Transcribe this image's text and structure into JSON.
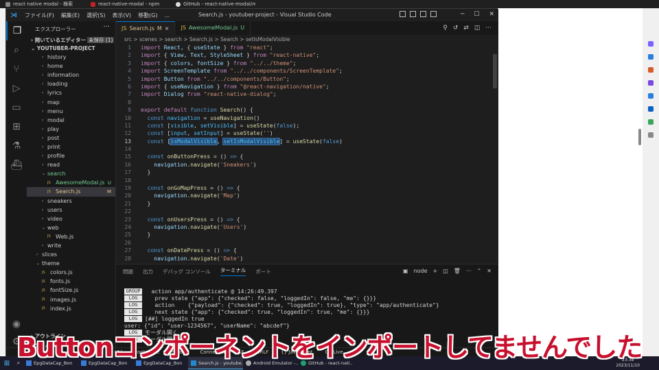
{
  "browser": {
    "tabs": [
      "react native modal - 検索",
      "react-native-modal - npm",
      "GitHub - react-native-modal/rea..."
    ]
  },
  "vscode": {
    "title": "Search.js - youtuber-project - Visual Studio Code",
    "menu": [
      "ファイル(F)",
      "編集(E)",
      "選択(S)",
      "表示(V)",
      "移動(G)",
      "..."
    ],
    "sidebar": {
      "header": "エクスプローラー",
      "open_editors": "開いているエディター",
      "unsaved": "未保存 (1)",
      "project": "YOUTUBER-PROJECT",
      "outline": "アウトライン",
      "timeline": "タイムライン",
      "tree": [
        {
          "label": "history",
          "kind": "folder",
          "indent": 2
        },
        {
          "label": "home",
          "kind": "folder",
          "indent": 2
        },
        {
          "label": "information",
          "kind": "folder",
          "indent": 2
        },
        {
          "label": "loading",
          "kind": "folder",
          "indent": 2
        },
        {
          "label": "lyrics",
          "kind": "folder",
          "indent": 2
        },
        {
          "label": "map",
          "kind": "folder",
          "indent": 2
        },
        {
          "label": "menu",
          "kind": "folder",
          "indent": 2
        },
        {
          "label": "modal",
          "kind": "folder",
          "indent": 2
        },
        {
          "label": "play",
          "kind": "folder",
          "indent": 2
        },
        {
          "label": "post",
          "kind": "folder",
          "indent": 2
        },
        {
          "label": "print",
          "kind": "folder",
          "indent": 2
        },
        {
          "label": "profile",
          "kind": "folder",
          "indent": 2
        },
        {
          "label": "read",
          "kind": "folder",
          "indent": 2
        },
        {
          "label": "search",
          "kind": "folder-open",
          "indent": 2,
          "status": "new"
        },
        {
          "label": "AwesomeModal.js",
          "kind": "file",
          "indent": 3,
          "status": "new",
          "badge": "U"
        },
        {
          "label": "Search.js",
          "kind": "file",
          "indent": 3,
          "status": "mod",
          "badge": "M",
          "selected": true
        },
        {
          "label": "sneakers",
          "kind": "folder",
          "indent": 2
        },
        {
          "label": "users",
          "kind": "folder",
          "indent": 2
        },
        {
          "label": "video",
          "kind": "folder",
          "indent": 2
        },
        {
          "label": "web",
          "kind": "folder-open",
          "indent": 2
        },
        {
          "label": "Web.js",
          "kind": "file",
          "indent": 3
        },
        {
          "label": "write",
          "kind": "folder",
          "indent": 2
        },
        {
          "label": "slices",
          "kind": "folder",
          "indent": 1
        },
        {
          "label": "theme",
          "kind": "folder-open",
          "indent": 1
        },
        {
          "label": "colors.js",
          "kind": "file",
          "indent": 2
        },
        {
          "label": "fonts.js",
          "kind": "file",
          "indent": 2
        },
        {
          "label": "fontSize.js",
          "kind": "file",
          "indent": 2
        },
        {
          "label": "images.js",
          "kind": "file",
          "indent": 2
        },
        {
          "label": "index.js",
          "kind": "file",
          "indent": 2
        }
      ]
    },
    "tabs": [
      {
        "name": "Search.js",
        "badge": "M",
        "active": true
      },
      {
        "name": "AwesomeModal.js",
        "badge": "U",
        "active": false
      }
    ],
    "breadcrumb": "src > scenes > search > Search.js > Search > setIsModalVisible",
    "current_line": 13,
    "code_lines": [
      {
        "n": 1,
        "html": "<span class='kw'>import</span> <span class='vr'>React</span>, { <span class='vr'>useState</span> } <span class='kw'>from</span> <span class='str'>\"react\"</span>;"
      },
      {
        "n": 2,
        "html": "<span class='kw'>import</span> { <span class='vr'>View</span>, <span class='vr'>Text</span>, <span class='vr'>StyleSheet</span> } <span class='kw'>from</span> <span class='str'>\"react-native\"</span>;"
      },
      {
        "n": 3,
        "html": "<span class='kw'>import</span> { <span class='vr'>colors</span>, <span class='vr'>fontSize</span> } <span class='kw'>from</span> <span class='str'>\"../../theme\"</span>;"
      },
      {
        "n": 4,
        "html": "<span class='kw'>import</span> <span class='vr'>ScreenTemplate</span> <span class='kw'>from</span> <span class='str'>\"../../components/ScreenTemplate\"</span>;"
      },
      {
        "n": 5,
        "html": "<span class='kw'>import</span> <span class='vr'>Button</span> <span class='kw'>from</span> <span class='str'>\"../../components/Button\"</span>;"
      },
      {
        "n": 6,
        "html": "<span class='kw'>import</span> { <span class='vr'>useNavigation</span> } <span class='kw'>from</span> <span class='str'>\"@react-navigation/native\"</span>;"
      },
      {
        "n": 7,
        "html": "<span class='kw'>import</span> <span class='vr'>Dialog</span> <span class='kw'>from</span> <span class='str'>\"react-native-dialog\"</span>;"
      },
      {
        "n": 8,
        "html": ""
      },
      {
        "n": 9,
        "html": "<span class='kw'>export</span> <span class='kw'>default</span> <span class='kb'>function</span> <span class='fn'>Search</span>() {"
      },
      {
        "n": 10,
        "html": "  <span class='kb'>const</span> <span class='cn'>navigation</span> = <span class='fn'>useNavigation</span>()"
      },
      {
        "n": 11,
        "html": "  <span class='kb'>const</span> [<span class='cn'>visible</span>, <span class='cn'>setVisible</span>] = <span class='fn'>useState</span>(<span class='kb'>false</span>);"
      },
      {
        "n": 12,
        "html": "  <span class='kb'>const</span> [<span class='cn'>input</span>, <span class='cn'>setInput</span>] = <span class='fn'>useState</span>(<span class='str'>''</span>)"
      },
      {
        "n": 13,
        "html": "  <span class='kb'>const</span> [<span class='cn hl'>isModalVisible</span>, <span class='cn hl'>setIsModalVisible</span>] = <span class='fn'>useState</span>(<span class='kb'>false</span>)"
      },
      {
        "n": 14,
        "html": ""
      },
      {
        "n": 15,
        "html": "  <span class='kb'>const</span> <span class='fn'>onButtonPress</span> = () <span class='kb'>=&gt;</span> {"
      },
      {
        "n": 16,
        "html": "    <span class='vr'>navigation</span>.<span class='fn'>navigate</span>(<span class='str'>'Sneakers'</span>)"
      },
      {
        "n": 17,
        "html": "  }"
      },
      {
        "n": 18,
        "html": ""
      },
      {
        "n": 19,
        "html": "  <span class='kb'>const</span> <span class='fn'>onGoMapPress</span> = () <span class='kb'>=&gt;</span> {"
      },
      {
        "n": 20,
        "html": "    <span class='vr'>navigation</span>.<span class='fn'>navigate</span>(<span class='str'>'Map'</span>)"
      },
      {
        "n": 21,
        "html": "  }"
      },
      {
        "n": 22,
        "html": ""
      },
      {
        "n": 23,
        "html": "  <span class='kb'>const</span> <span class='fn'>onUsersPress</span> = () <span class='kb'>=&gt;</span> {"
      },
      {
        "n": 24,
        "html": "    <span class='vr'>navigation</span>.<span class='fn'>navigate</span>(<span class='str'>'Users'</span>)"
      },
      {
        "n": 25,
        "html": "  }"
      },
      {
        "n": 26,
        "html": ""
      },
      {
        "n": 27,
        "html": "  <span class='kb'>const</span> <span class='fn'>onDatePress</span> = () <span class='kb'>=&gt;</span> {"
      },
      {
        "n": 28,
        "html": "    <span class='vr'>navigation</span>.<span class='fn'>navigate</span>(<span class='str'>'Date'</span>)"
      }
    ],
    "panel": {
      "tabs": [
        "問題",
        "出力",
        "デバッグ コンソール",
        "ターミナル",
        "ポート"
      ],
      "active_tab": "ターミナル",
      "terminal_name": "node",
      "lines": [
        {
          "label": "GROUP",
          "text": "  action app/authenticate @ 14:26:49.397"
        },
        {
          "label": "LOG",
          "text": "   prev state {\"app\": {\"checked\": false, \"loggedIn\": false, \"me\": {}}}"
        },
        {
          "label": "LOG",
          "text": "   action    {\"payload\": {\"checked\": true, \"loggedIn\": true}, \"type\": \"app/authenticate\"}"
        },
        {
          "label": "LOG",
          "text": "   next state {\"app\": {\"checked\": true, \"loggedIn\": true, \"me\": {}}}"
        },
        {
          "label": "LOG",
          "text": "[##] loggedIn true"
        },
        {
          "label": "",
          "text": "user: {\"id\": \"user-1234567\", \"userName\": \"abcdef\"}"
        },
        {
          "label": "LOG",
          "text": "モーダル開く"
        },
        {
          "label": "LOG",
          "text": "モーダル開く"
        }
      ]
    },
    "status": [
      "React",
      "(↑)",
      "contribute",
      "mbolic",
      "Connect to",
      "LF",
      "CRLF",
      "{} JavaScript",
      "Go Live"
    ]
  },
  "taskbar": {
    "apps": [
      "EpgDataCap_Bon",
      "EpgDataCap_Bon",
      "EpgDataCap_Bon",
      "Search.js - youtube...",
      "Android Emulator -...",
      "GitHub - react-nati..."
    ],
    "time": "23:38",
    "date": "2023/11/10"
  },
  "subtitle": "Buttonコンポーネントをインポートしてませんでした"
}
